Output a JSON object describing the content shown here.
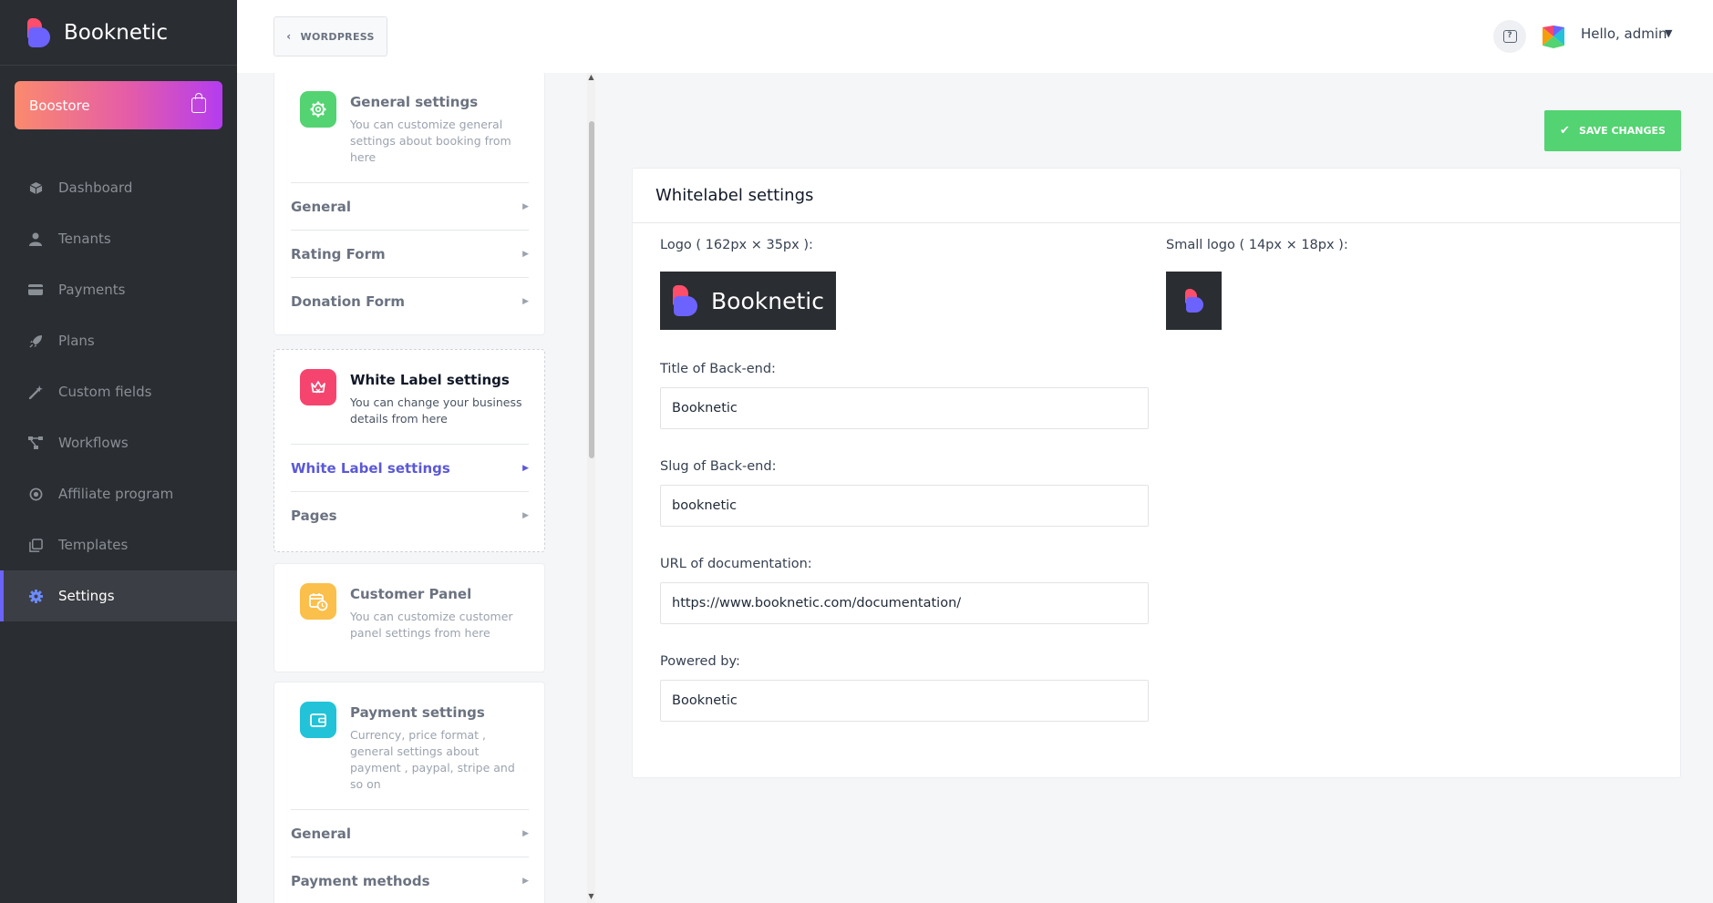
{
  "brand": {
    "name": "Booknetic"
  },
  "boostore": {
    "label": "Boostore"
  },
  "nav": [
    {
      "label": "Dashboard",
      "icon": "cube-icon"
    },
    {
      "label": "Tenants",
      "icon": "user-icon"
    },
    {
      "label": "Payments",
      "icon": "credit-card-icon"
    },
    {
      "label": "Plans",
      "icon": "rocket-icon"
    },
    {
      "label": "Custom fields",
      "icon": "magic-wand-icon"
    },
    {
      "label": "Workflows",
      "icon": "workflow-icon"
    },
    {
      "label": "Affiliate program",
      "icon": "target-icon"
    },
    {
      "label": "Templates",
      "icon": "copy-icon"
    },
    {
      "label": "Settings",
      "icon": "gear-icon",
      "active": true
    }
  ],
  "topbar": {
    "wordpress_label": "WORDPRESS",
    "greeting": "Hello, admin"
  },
  "settings_cards": [
    {
      "title": "General settings",
      "description": "You can customize general settings about booking from here",
      "links": [
        "General",
        "Rating Form",
        "Donation Form"
      ],
      "color": "#53d371"
    },
    {
      "title": "White Label settings",
      "description": "You can change your business details from here",
      "links": [
        "White Label settings",
        "Pages"
      ],
      "color": "#f5456f",
      "active_link": "White Label settings"
    },
    {
      "title": "Customer Panel",
      "description": "You can customize customer panel settings from here",
      "links": [],
      "color": "#fbbf4b"
    },
    {
      "title": "Payment settings",
      "description": "Currency, price format , general settings about payment , paypal, stripe and so on",
      "links": [
        "General",
        "Payment methods"
      ],
      "color": "#22c3d8"
    }
  ],
  "save_button": {
    "label": "SAVE CHANGES"
  },
  "whitelabel": {
    "title": "Whitelabel settings",
    "logo_label": "Logo ( 162px × 35px ):",
    "small_logo_label": "Small logo ( 14px × 18px ):",
    "logo_text": "Booknetic",
    "fields": [
      {
        "label": "Title of Back-end:",
        "value": "Booknetic"
      },
      {
        "label": "Slug of Back-end:",
        "value": "booknetic"
      },
      {
        "label": "URL of documentation:",
        "value": "https://www.booknetic.com/documentation/"
      },
      {
        "label": "Powered by:",
        "value": "Booknetic"
      }
    ]
  }
}
